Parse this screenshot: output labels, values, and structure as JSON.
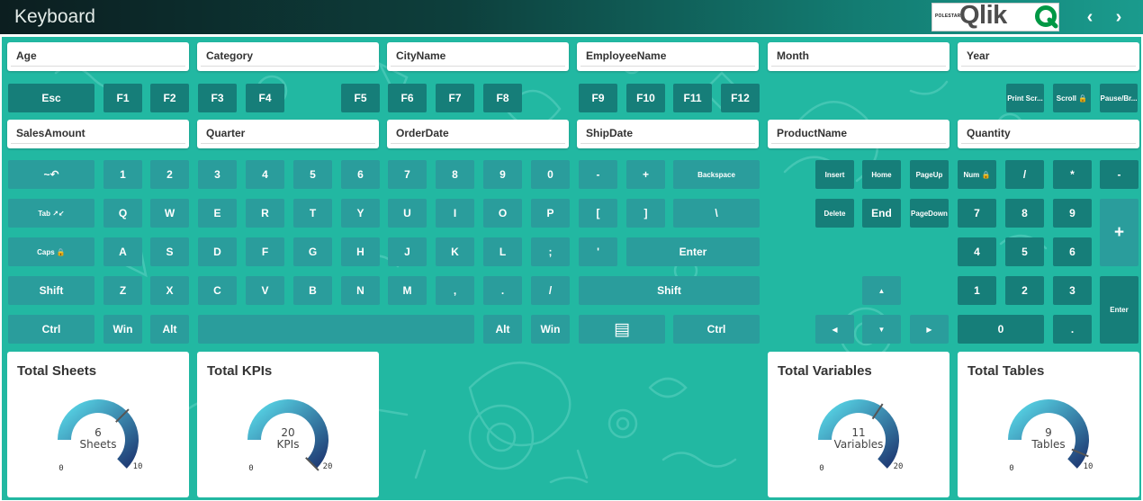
{
  "app": {
    "title": "Keyboard",
    "brand_small": "POLESTAR",
    "brand": "Qlik",
    "nav_prev": "‹",
    "nav_next": "›"
  },
  "filters_row1": [
    "Age",
    "Category",
    "CityName",
    "EmployeeName",
    "Month",
    "Year"
  ],
  "filters_row2": [
    "SalesAmount",
    "Quarter",
    "OrderDate",
    "ShipDate",
    "ProductName",
    "Quantity"
  ],
  "function_keys": [
    "Esc",
    "F1",
    "F2",
    "F3",
    "F4",
    "F5",
    "F6",
    "F7",
    "F8",
    "F9",
    "F10",
    "F11",
    "F12",
    "Print Scr...",
    "Scroll 🔒",
    "Pause/Br..."
  ],
  "main_keys": {
    "row1": [
      "~↶",
      "1",
      "2",
      "3",
      "4",
      "5",
      "6",
      "7",
      "8",
      "9",
      "0",
      "-",
      "+",
      "Backspace"
    ],
    "row2": [
      "Tab ↗↙",
      "Q",
      "W",
      "E",
      "R",
      "T",
      "Y",
      "U",
      "I",
      "O",
      "P",
      "[",
      "]",
      "\\"
    ],
    "row3": [
      "Caps 🔒",
      "A",
      "S",
      "D",
      "F",
      "G",
      "H",
      "J",
      "K",
      "L",
      ";",
      "'",
      "Enter"
    ],
    "row4": [
      "Shift",
      "Z",
      "X",
      "C",
      "V",
      "B",
      "N",
      "M",
      ",",
      ".",
      "/",
      "Shift"
    ],
    "row5": [
      "Ctrl",
      "Win",
      "Alt",
      "",
      "Alt",
      "Win",
      "▤",
      "Ctrl"
    ]
  },
  "nav_keys": [
    "Insert",
    "Home",
    "PageUp",
    "Delete",
    "End",
    "PageDown",
    "▲",
    "◀",
    "▼",
    "▶"
  ],
  "numpad_keys": [
    "Num 🔒",
    "/",
    "*",
    "-",
    "7",
    "8",
    "9",
    "+",
    "4",
    "5",
    "6",
    "1",
    "2",
    "3",
    "Enter",
    "0",
    "."
  ],
  "kpis": [
    {
      "title": "Total Sheets",
      "value": "6",
      "label": "Sheets",
      "min": "0",
      "max": "10",
      "fraction": 0.6
    },
    {
      "title": "Total KPIs",
      "value": "20",
      "label": "KPIs",
      "min": "0",
      "max": "20",
      "fraction": 1.0
    },
    {
      "title": "Total Variables",
      "value": "11",
      "label": "Variables",
      "min": "0",
      "max": "20",
      "fraction": 0.55
    },
    {
      "title": "Total Tables",
      "value": "9",
      "label": "Tables",
      "min": "0",
      "max": "10",
      "fraction": 0.9
    }
  ],
  "colors": {
    "background": "#22b8a2",
    "key_dark": "#167e79",
    "key_light": "#2a9d9c",
    "gauge_start": "#5ee8f4",
    "gauge_end": "#1a2d6a"
  }
}
